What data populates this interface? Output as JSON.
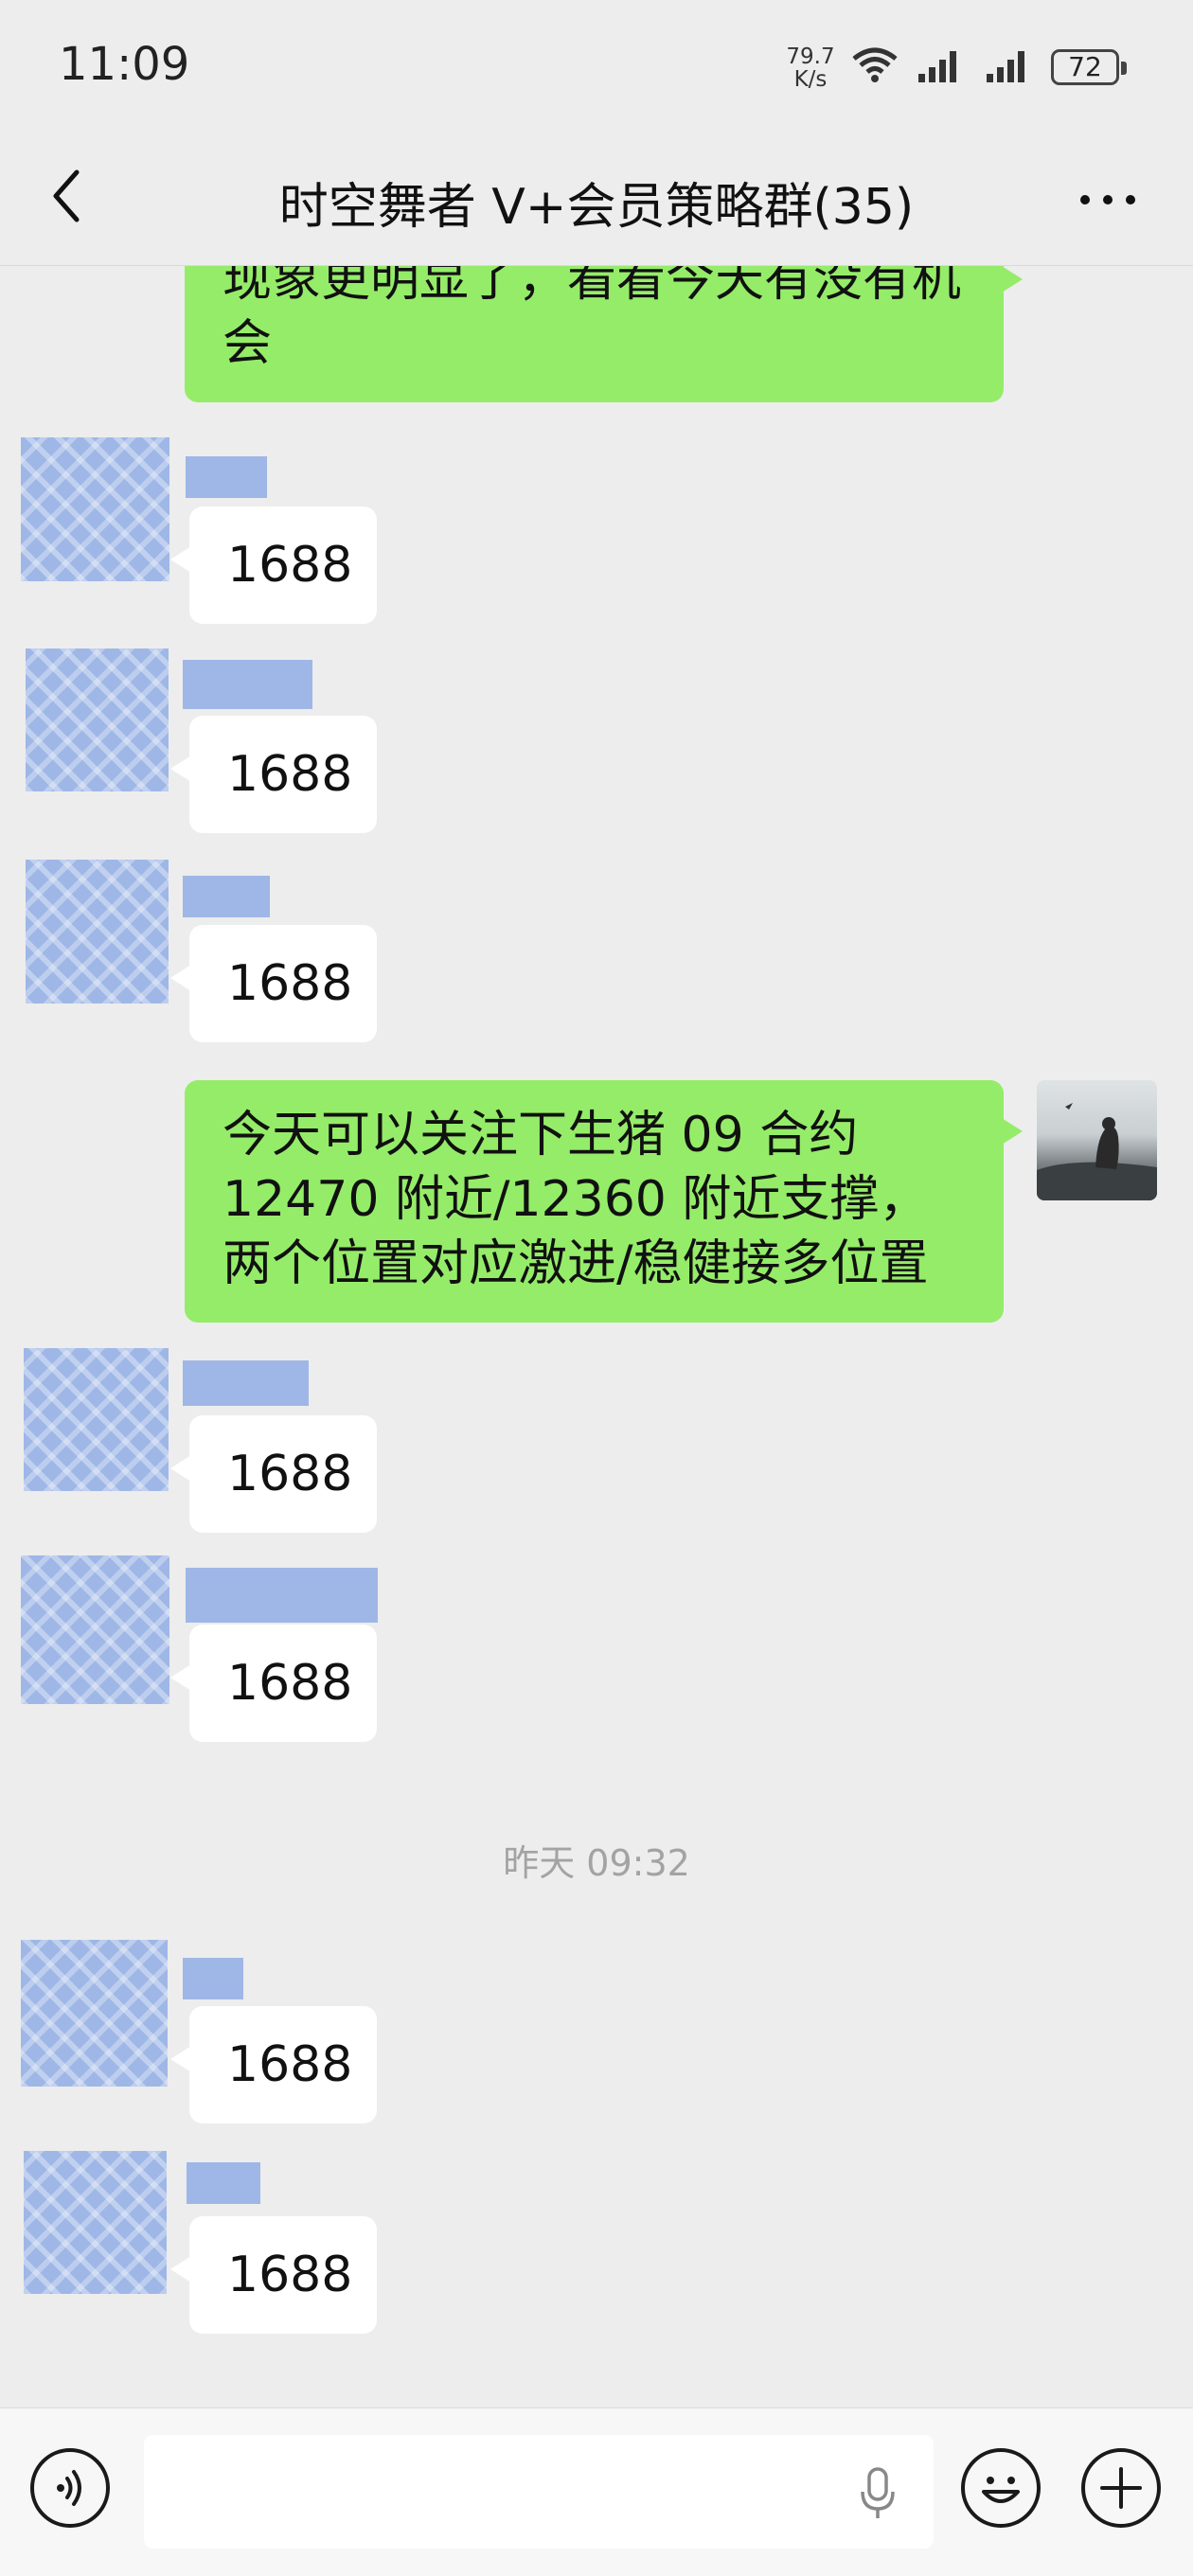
{
  "status_bar": {
    "time": "11:09",
    "net_speed_value": "79.7",
    "net_speed_unit": "K/s",
    "battery": "72"
  },
  "header": {
    "title": "时空舞者 V+会员策略群(35)"
  },
  "messages": {
    "m0": {
      "text": "现象更明显了，看看今天有没有机会"
    },
    "m1": {
      "text": "1688"
    },
    "m2": {
      "text": "1688"
    },
    "m3": {
      "text": "1688"
    },
    "m4": {
      "text": "今天可以关注下生猪 09 合约 12470 附近/12360 附近支撑，两个位置对应激进/稳健接多位置"
    },
    "m5": {
      "text": "1688"
    },
    "m6": {
      "text": "1688"
    },
    "timestamp": "昨天 09:32",
    "m7": {
      "text": "1688"
    },
    "m8": {
      "text": "1688"
    }
  },
  "input_bar": {
    "placeholder": ""
  },
  "icons": {
    "back": "chevron-left-icon",
    "more": "more-dots-icon",
    "voice": "voice-icon",
    "mic": "microphone-icon",
    "emoji": "emoji-icon",
    "plus": "plus-icon"
  },
  "colors": {
    "background": "#ededed",
    "outgoing_bubble": "#95ec69",
    "incoming_bubble": "#ffffff",
    "timestamp_text": "#a3a3a3"
  }
}
